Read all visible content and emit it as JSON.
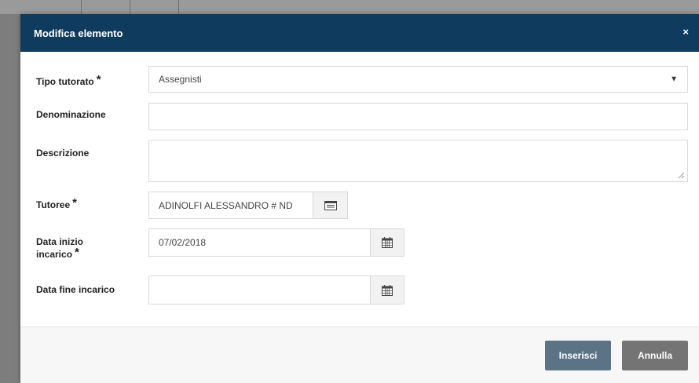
{
  "modal": {
    "title": "Modifica elemento",
    "close_label": "×"
  },
  "form": {
    "tipo_tutorato": {
      "label": "Tipo tutorato",
      "required_mark": "*",
      "value": "Assegnisti",
      "arrow": "▼"
    },
    "denominazione": {
      "label": "Denominazione",
      "value": ""
    },
    "descrizione": {
      "label": "Descrizione",
      "value": ""
    },
    "tutoree": {
      "label": "Tutoree",
      "required_mark": "*",
      "value": "ADINOLFI ALESSANDRO # ND"
    },
    "data_inizio": {
      "label_line1": "Data inizio",
      "label_line2": "incarico",
      "required_mark": "*",
      "value": "07/02/2018"
    },
    "data_fine": {
      "label": "Data fine incarico",
      "value": ""
    }
  },
  "footer": {
    "insert_label": "Inserisci",
    "cancel_label": "Annulla"
  },
  "colors": {
    "header": "#0f3b5f",
    "primary_button": "#5c7385",
    "secondary_button": "#747474"
  },
  "icons": {
    "tutoree_addon": "list-card-icon",
    "date_addon": "calendar-icon"
  }
}
